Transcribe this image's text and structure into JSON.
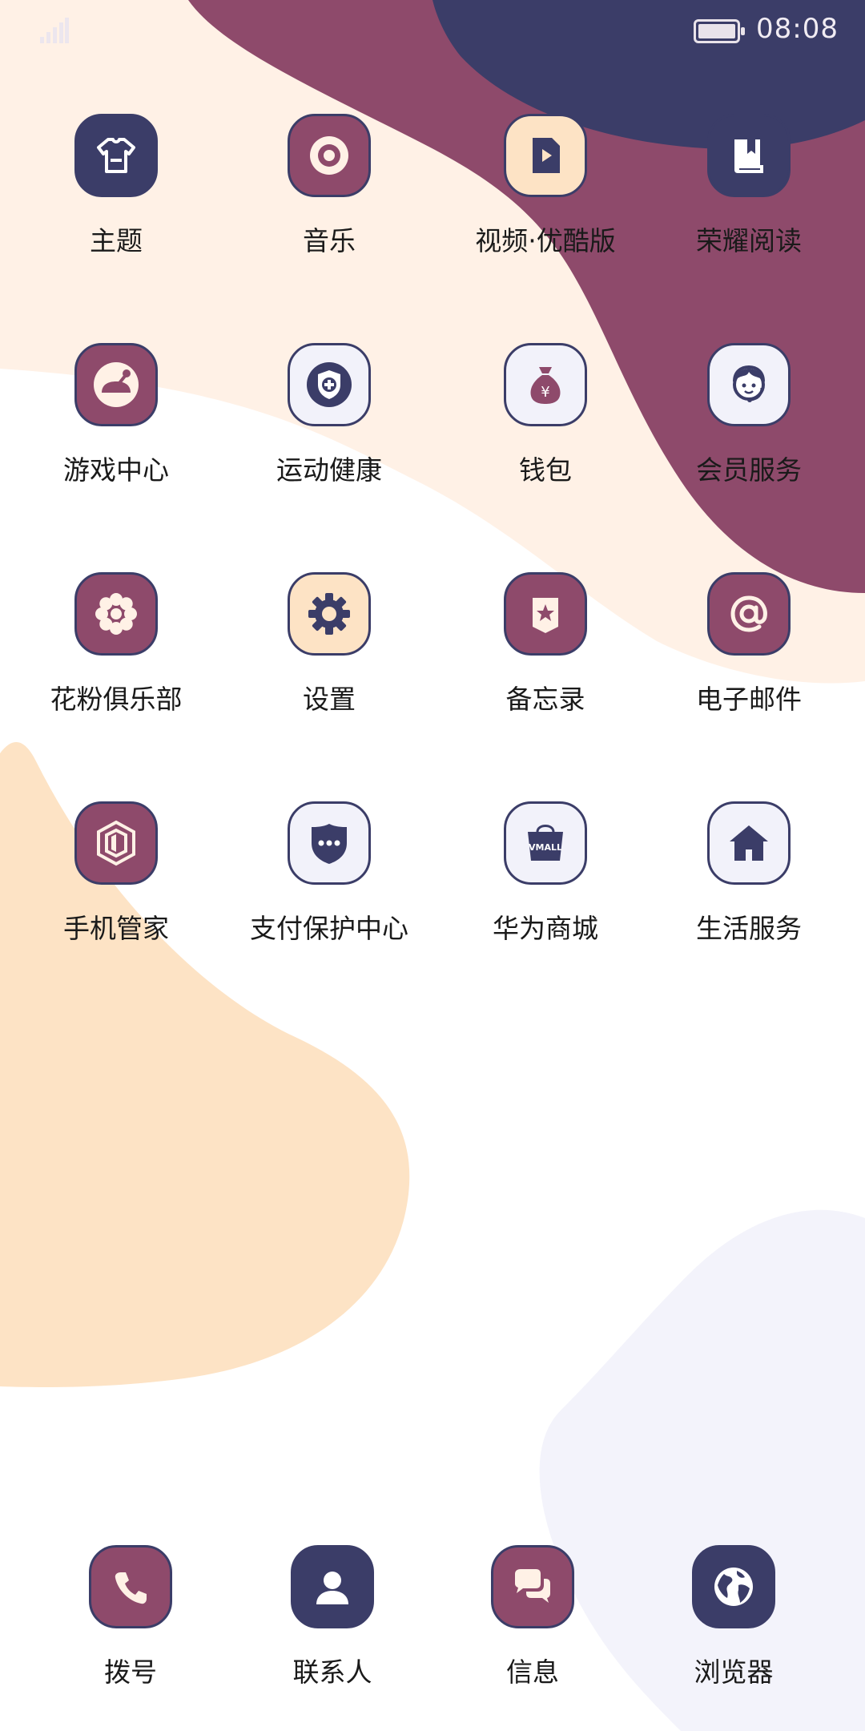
{
  "status": {
    "time": "08:08"
  },
  "apps": [
    {
      "label": "主题",
      "icon": "theme-shirt-icon"
    },
    {
      "label": "音乐",
      "icon": "music-disc-icon"
    },
    {
      "label": "视频·优酷版",
      "icon": "video-file-icon"
    },
    {
      "label": "荣耀阅读",
      "icon": "book-icon"
    },
    {
      "label": "游戏中心",
      "icon": "joystick-icon"
    },
    {
      "label": "运动健康",
      "icon": "health-shield-icon"
    },
    {
      "label": "钱包",
      "icon": "money-bag-icon"
    },
    {
      "label": "会员服务",
      "icon": "headset-agent-icon"
    },
    {
      "label": "花粉俱乐部",
      "icon": "flower-icon"
    },
    {
      "label": "设置",
      "icon": "gear-icon"
    },
    {
      "label": "备忘录",
      "icon": "star-bookmark-icon"
    },
    {
      "label": "电子邮件",
      "icon": "at-sign-icon"
    },
    {
      "label": "手机管家",
      "icon": "security-hexagon-icon"
    },
    {
      "label": "支付保护中心",
      "icon": "chat-shield-icon"
    },
    {
      "label": "华为商城",
      "icon": "vmall-bag-icon"
    },
    {
      "label": "生活服务",
      "icon": "house-icon"
    }
  ],
  "vmall_text": "VMALL",
  "dock": [
    {
      "label": "拨号",
      "icon": "phone-icon"
    },
    {
      "label": "联系人",
      "icon": "contact-person-icon"
    },
    {
      "label": "信息",
      "icon": "message-bubbles-icon"
    },
    {
      "label": "浏览器",
      "icon": "globe-icon"
    }
  ],
  "colors": {
    "purple": "#8e4a6b",
    "navy": "#3b3d68",
    "peach": "#fde3c5",
    "cream": "#fff1e6",
    "lavender": "#f3f3fb"
  }
}
